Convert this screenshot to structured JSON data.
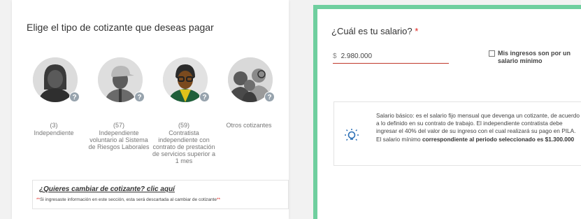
{
  "left": {
    "title": "Elige el tipo de cotizante que deseas pagar",
    "options": [
      {
        "count": "(3)",
        "label": "Independiente",
        "icon": "person-woman-icon"
      },
      {
        "count": "(57)",
        "label": "Independiente voluntario al Sistema de Riesgos Laborales",
        "icon": "person-cap-icon"
      },
      {
        "count": "(59)",
        "label": "Contratista independiente con contrato de prestación de servicios superior a 1 mes",
        "icon": "person-contractor-icon"
      },
      {
        "count": "",
        "label": "Otros cotizantes",
        "icon": "people-group-icon"
      }
    ],
    "help_glyph": "?",
    "change_link": "¿Quieres cambiar de cotizante? clic aquí",
    "change_note_asterisk_start": "**",
    "change_note": "Si ingresaste información en este sección, esta será descartada al cambiar de cotizante",
    "change_note_asterisk_end": "**"
  },
  "right": {
    "salary_title": "¿Cuál es tu salario?",
    "required_mark": "*",
    "currency_symbol": "$",
    "salary_value": "2.980.000",
    "min_wage_label": "Mis ingresos son por un salario mínimo",
    "min_wage_checked": false,
    "info_text_plain": "Salario básico: es el salario fijo mensual que devenga un cotizante, de acuerdo a lo definido en su contrato de trabajo. El independiente contratista debe ingresar el 40% del valor de su ingreso con el cual realizará su pago en PILA. El salario mínimo ",
    "info_text_bold": "correspondiente al periodo seleccionado es $1.300.000",
    "info_icon": "lightbulb-icon"
  },
  "colors": {
    "accent_green": "#6fcf9f",
    "required_red": "#e0221d",
    "input_underline": "#c0392b",
    "help_badge": "#97a3ad"
  }
}
